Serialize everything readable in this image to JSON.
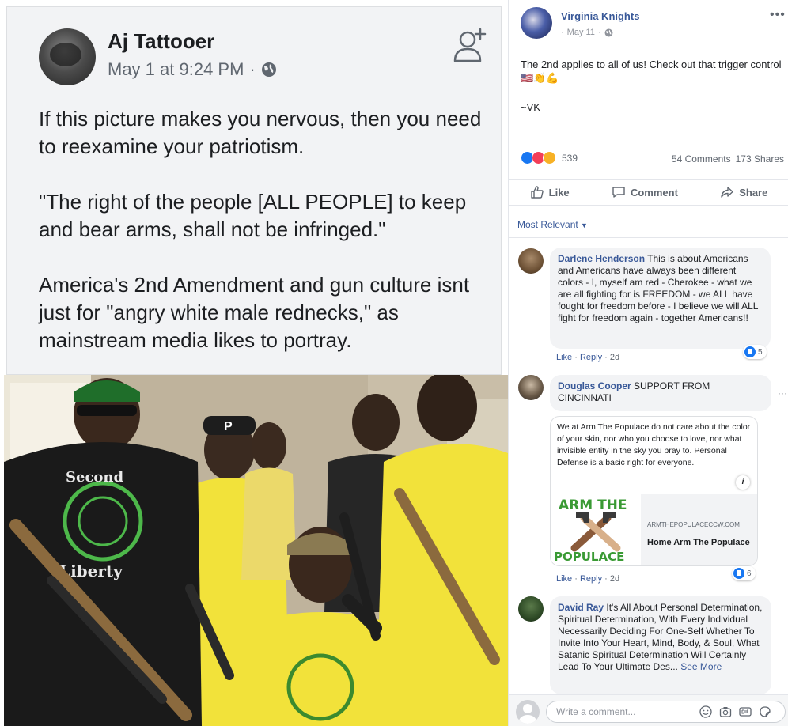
{
  "left_post": {
    "author": "Aj Tattooer",
    "timestamp": "May 1 at 9:24 PM",
    "separator": "·",
    "paragraphs": [
      "If this picture makes you nervous, then you need to reexamine your patriotism.",
      "\"The right of the people [ALL PEOPLE] to keep and bear arms, shall not be infringed.\"",
      "America's 2nd Amendment and gun culture isnt just for \"angry white male rednecks,\" as mainstream media likes to portray."
    ],
    "photo_shirt_text": {
      "top": "Second",
      "bottom": "Liberty"
    }
  },
  "right_post": {
    "page_name": "Virginia Knights",
    "date": "May 11",
    "separator": "·",
    "more": "•••",
    "text": "The 2nd applies to all of us! Check out that trigger control 🇺🇸👏💪",
    "signature": "~VK",
    "reaction_count": "539",
    "comments": "54 Comments",
    "shares": "173 Shares",
    "actions": {
      "like": "Like",
      "comment": "Comment",
      "share": "Share"
    },
    "sort": "Most Relevant"
  },
  "comments": [
    {
      "name": "Darlene Henderson",
      "text": "This is about Americans and Americans have always been different colors - I, myself am red - Cherokee - what we are all fighting for is FREEDOM - we ALL have fought for freedom before - I believe we will ALL fight for freedom again - together Americans!!",
      "like": "Like",
      "reply": "Reply",
      "age": "2d",
      "likes": "5"
    },
    {
      "name": "Douglas Cooper",
      "text": "SUPPORT FROM CINCINNATI",
      "attachment_text": "We at Arm The Populace do not care about the color of your skin, nor who you choose to love, nor what invisible entity in the sky you pray to. Personal Defense is a basic right for everyone.",
      "info": "i",
      "logo_top": "ARM THE",
      "logo_bottom": "POPULACE",
      "link_domain": "ARMTHEPOPULACECCW.COM",
      "link_title": "Home Arm The Populace",
      "more": "···",
      "like": "Like",
      "reply": "Reply",
      "age": "2d",
      "likes": "6"
    },
    {
      "name": "David Ray",
      "text": "It's All About Personal Determination, Spiritual Determination, With Every Individual Necessarily Deciding For One-Self Whether To Invite Into Your Heart, Mind, Body, & Soul, What Satanic Spiritual Determination Will Certainly Lead To Your Ultimate Des...",
      "see_more": "See More"
    }
  ],
  "composer": {
    "placeholder": "Write a comment..."
  },
  "colors": {
    "link_blue": "#385898",
    "like_blue": "#1877f2",
    "text_dark": "#1c1e21",
    "text_muted": "#606770",
    "bubble_gray": "#f2f3f5",
    "shirt_yellow": "#f2e23a",
    "shirt_green": "#3c8a2e"
  },
  "icons": [
    "follow-person-icon",
    "globe-icon",
    "like-thumb-icon",
    "comment-icon",
    "share-icon",
    "caret-down-icon",
    "emoji-icon",
    "camera-icon",
    "gif-icon",
    "sticker-icon",
    "info-icon"
  ]
}
